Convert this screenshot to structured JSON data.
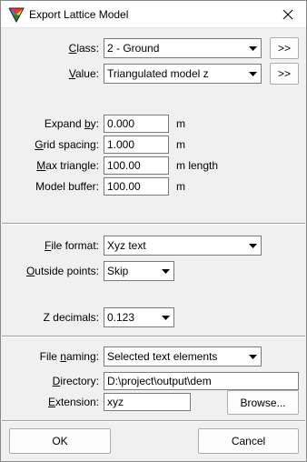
{
  "window": {
    "title": "Export Lattice Model"
  },
  "class": {
    "label_pre": "",
    "label_key": "C",
    "label_post": "lass:",
    "value": "2 - Ground",
    "button": ">>"
  },
  "value": {
    "label_pre": "",
    "label_key": "V",
    "label_post": "alue:",
    "value": "Triangulated model z",
    "button": ">>"
  },
  "expand_by": {
    "label_pre": "Expand ",
    "label_key": "b",
    "label_post": "y:",
    "value": "0.000",
    "unit": "m"
  },
  "grid_spacing": {
    "label_pre": "",
    "label_key": "G",
    "label_post": "rid spacing:",
    "value": "1.000",
    "unit": "m"
  },
  "max_triangle": {
    "label_pre": "",
    "label_key": "M",
    "label_post": "ax triangle:",
    "value": "100.00",
    "unit": "m length"
  },
  "model_buffer": {
    "label": "Model buffer:",
    "value": "100.00",
    "unit": "m"
  },
  "file_format": {
    "label_pre": "",
    "label_key": "F",
    "label_post": "ile format:",
    "value": "Xyz text"
  },
  "outside_points": {
    "label_pre": "",
    "label_key": "O",
    "label_post": "utside points:",
    "value": "Skip"
  },
  "z_decimals": {
    "label": "Z decimals:",
    "value": "0.123"
  },
  "file_naming": {
    "label_pre": "File ",
    "label_key": "n",
    "label_post": "aming:",
    "value": "Selected text elements"
  },
  "directory": {
    "label_pre": "",
    "label_key": "D",
    "label_post": "irectory:",
    "value": "D:\\project\\output\\dem"
  },
  "extension": {
    "label_pre": "",
    "label_key": "E",
    "label_post": "xtension:",
    "value": "xyz",
    "browse": "Browse..."
  },
  "footer": {
    "ok": "OK",
    "cancel": "Cancel"
  }
}
